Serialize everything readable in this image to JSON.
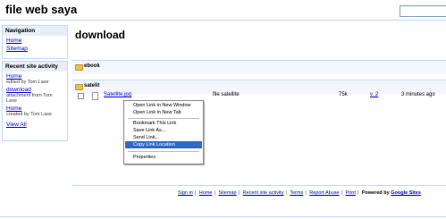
{
  "header": {
    "title": "file web saya"
  },
  "sidebar": {
    "navigation": {
      "title": "Navigation",
      "items": [
        "Home",
        "Sitemap"
      ]
    },
    "activity": {
      "title": "Recent site activity",
      "entries": [
        {
          "link": "Home",
          "meta": "edited by Tom Lase"
        },
        {
          "link": "download",
          "meta": "attachment from Tom Lase"
        },
        {
          "link": "Home",
          "meta": "created by Tom Lase"
        }
      ],
      "view_all": "View All"
    }
  },
  "main": {
    "heading": "download",
    "folders": [
      "ebook",
      "satelit"
    ],
    "file": {
      "name": "Satellite.jpg",
      "description": "file satellite",
      "size": "75k",
      "version": "v. 2",
      "time": "3 minutes ago"
    }
  },
  "context_menu": {
    "items": [
      "Open Link in New Window",
      "Open Link in New Tab",
      "Bookmark This Link",
      "Save Link As...",
      "Send Link...",
      "Copy Link Location",
      "Properties"
    ],
    "selected": "Copy Link Location"
  },
  "footer": {
    "links": [
      "Sign in",
      "Home",
      "Sitemap",
      "Recent site activity",
      "Terms",
      "Report Abuse",
      "Print"
    ],
    "powered_prefix": "Powered by",
    "powered_brand": "Google Sites"
  },
  "colors": {
    "accent": "#c3d9ff",
    "sidebar_header": "#e8eef7",
    "link": "#0000cc",
    "menu_highlight": "#316ac5"
  }
}
